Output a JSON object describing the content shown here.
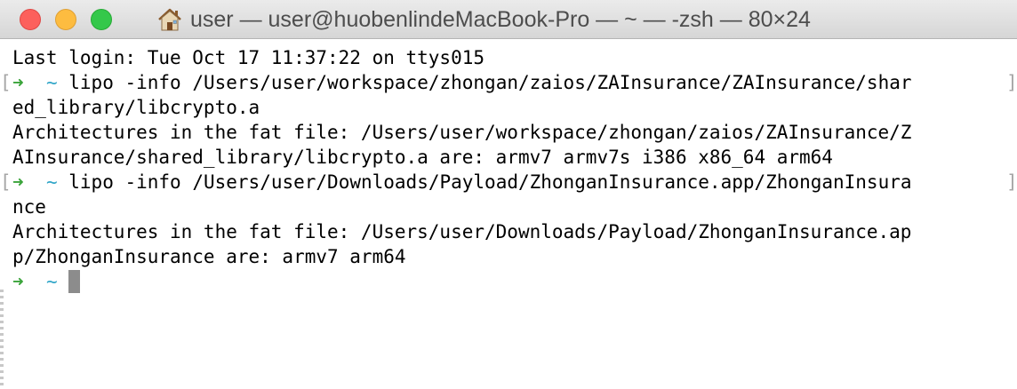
{
  "window": {
    "title": "user — user@huobenlindeMacBook-Pro — ~ — -zsh — 80×24",
    "title_icon": "home-icon",
    "traffic_lights": {
      "close": "#fc605c",
      "minimize": "#fdbc40",
      "zoom": "#34c84a"
    }
  },
  "terminal": {
    "colors": {
      "prompt_arrow": "#3aa43a",
      "prompt_tilde": "#31a6c8",
      "text": "#000000",
      "cursor": "#8c8c8c"
    },
    "prompt": {
      "arrow": "➜",
      "dir": "~"
    },
    "lines": [
      "Last login: Tue Oct 17 11:37:22 on ttys015",
      "lipo -info /Users/user/workspace/zhongan/zaios/ZAInsurance/ZAInsurance/shar",
      "ed_library/libcrypto.a",
      "Architectures in the fat file: /Users/user/workspace/zhongan/zaios/ZAInsurance/Z",
      "AInsurance/shared_library/libcrypto.a are: armv7 armv7s i386 x86_64 arm64",
      "lipo -info /Users/user/Downloads/Payload/ZhonganInsurance.app/ZhonganInsura",
      "nce",
      "Architectures in the fat file: /Users/user/Downloads/Payload/ZhonganInsurance.ap",
      "p/ZhonganInsurance are: armv7 arm64"
    ],
    "mark_open": "[",
    "mark_close": "]"
  }
}
